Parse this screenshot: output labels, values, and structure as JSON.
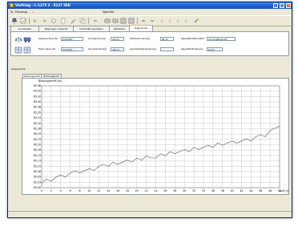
{
  "window": {
    "title": "Vielfrieg – L-1275 2 . 8127 5ER"
  },
  "menu": [
    "Sr.",
    "Fahrzeug",
    "...",
    "Speicher"
  ],
  "tabs": [
    {
      "label": "Grunddaten",
      "active": false
    },
    {
      "label": "Wägungen / Gewicht",
      "active": false
    },
    {
      "label": "Unterhaltungs-Daten",
      "active": false
    },
    {
      "label": "Statistiken",
      "active": false
    },
    {
      "label": "Diagramme",
      "active": true
    }
  ],
  "info": {
    "fields": [
      {
        "label": "Gleisanschluss-Nr",
        "value": "Z-E27502"
      },
      {
        "label": "Ist-Gewicht [kg]",
        "value": "183.11"
      },
      {
        "label": "Prüfanschluss [kg]",
        "value": "80.74"
      },
      {
        "label": "Kapazität-Datum/Zeit",
        "value": "07.10.2009 06:44"
      },
      {
        "label": "Fahrz.-Raum-Nr.",
        "value": "Z-E27502"
      },
      {
        "label": "Soll-Gewicht [kg]",
        "value": "190.11"
      },
      {
        "label": "Gesamt-Restmenge [kg]",
        "value": ""
      },
      {
        "label": "Kapazität-Einteilung",
        "value": "Lemrs"
      }
    ]
  },
  "section": {
    "label": "Diagramme"
  },
  "subtabs": [
    {
      "label": "Bildungsprofil",
      "active": true
    },
    {
      "label": "Bildungsprofil",
      "active": false
    }
  ],
  "chart_data": {
    "type": "line",
    "title": "Bildungsprofil [m]",
    "xlabel": "Lauf. [m]",
    "ylabel": "",
    "ylim": [
      65.0,
      65.48
    ],
    "xlim": [
      0,
      50
    ],
    "y_ticks": [
      "65.48",
      "65.45",
      "65.42",
      "65.40",
      "65.38",
      "65.35",
      "65.33",
      "65.30",
      "65.28",
      "65.25",
      "65.23",
      "65.20",
      "65.18",
      "65.15",
      "65.13",
      "65.10",
      "65.08",
      "65.05",
      "65.03",
      "65.00"
    ],
    "x_ticks": [
      "0",
      "2",
      "4",
      "6",
      "8",
      "10",
      "12",
      "14",
      "16",
      "18",
      "20",
      "22",
      "24",
      "26",
      "28",
      "30",
      "32",
      "34",
      "36",
      "38",
      "40",
      "42",
      "44",
      "46",
      "48",
      "50"
    ],
    "grid": true,
    "series": [
      {
        "color": "#555555",
        "x": [
          0,
          1,
          2,
          3,
          4,
          5,
          6,
          7,
          8,
          9,
          10,
          11,
          12,
          13,
          14,
          15,
          16,
          17,
          18,
          19,
          20,
          21,
          22,
          23,
          24,
          25,
          26,
          27,
          28,
          29,
          30,
          31,
          32,
          33,
          34,
          35,
          36,
          37,
          38,
          39,
          40,
          41,
          42,
          43,
          44,
          45,
          46,
          47,
          48,
          49,
          50
        ],
        "y": [
          65.02,
          65.04,
          65.03,
          65.05,
          65.06,
          65.05,
          65.07,
          65.08,
          65.07,
          65.08,
          65.09,
          65.08,
          65.1,
          65.11,
          65.1,
          65.12,
          65.11,
          65.12,
          65.13,
          65.12,
          65.14,
          65.13,
          65.15,
          65.14,
          65.14,
          65.16,
          65.15,
          65.17,
          65.16,
          65.17,
          65.18,
          65.17,
          65.19,
          65.18,
          65.19,
          65.2,
          65.19,
          65.21,
          65.2,
          65.21,
          65.22,
          65.21,
          65.22,
          65.23,
          65.22,
          65.24,
          65.25,
          65.24,
          65.27,
          65.28,
          65.29
        ]
      }
    ]
  },
  "colors": {
    "titlebar": "#1f5fd6",
    "accent": "#e2b850",
    "window": "#ece9d8"
  }
}
